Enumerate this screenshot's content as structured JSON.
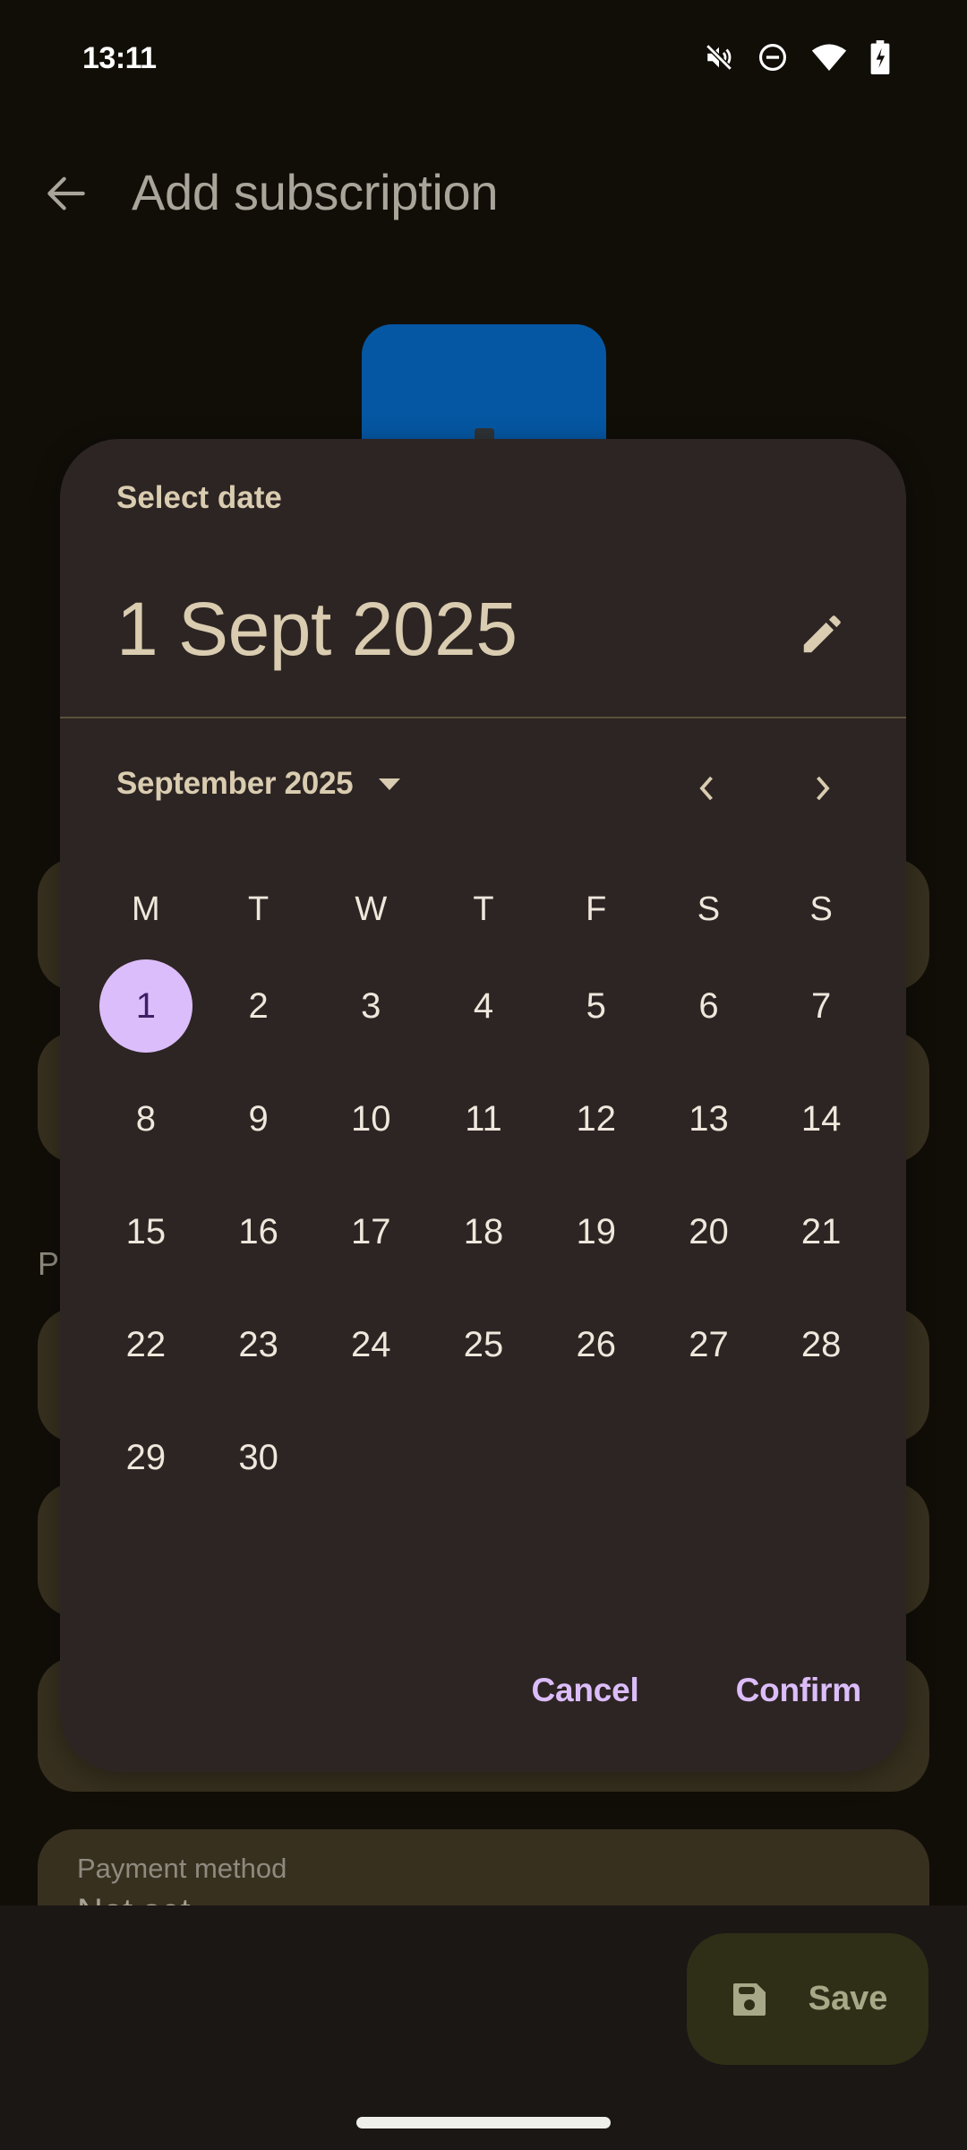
{
  "status_bar": {
    "time": "13:11",
    "icons": [
      "mute-icon",
      "do-not-disturb-icon",
      "wifi-icon",
      "battery-charging-icon"
    ]
  },
  "app_bar": {
    "back_icon": "arrow-back-icon",
    "title": "Add subscription"
  },
  "background_form": {
    "section_label_partial": "P",
    "payment_method": {
      "label": "Payment method",
      "value_partial": "Not set"
    }
  },
  "fab": {
    "icon": "save-icon",
    "label": "Save"
  },
  "date_picker": {
    "headline": "Select date",
    "selected_date_text": "1 Sept 2025",
    "edit_icon": "edit-pencil-icon",
    "month_year_label": "September 2025",
    "dropdown_icon": "arrow-drop-down-icon",
    "prev_icon": "chevron-left-icon",
    "next_icon": "chevron-right-icon",
    "weekdays": [
      "M",
      "T",
      "W",
      "T",
      "F",
      "S",
      "S"
    ],
    "weeks": [
      [
        "1",
        "2",
        "3",
        "4",
        "5",
        "6",
        "7"
      ],
      [
        "8",
        "9",
        "10",
        "11",
        "12",
        "13",
        "14"
      ],
      [
        "15",
        "16",
        "17",
        "18",
        "19",
        "20",
        "21"
      ],
      [
        "22",
        "23",
        "24",
        "25",
        "26",
        "27",
        "28"
      ],
      [
        "29",
        "30",
        "",
        "",
        "",
        "",
        ""
      ]
    ],
    "selected_day": "1",
    "cancel_label": "Cancel",
    "confirm_label": "Confirm",
    "accent_color": "#dcbdfb"
  }
}
